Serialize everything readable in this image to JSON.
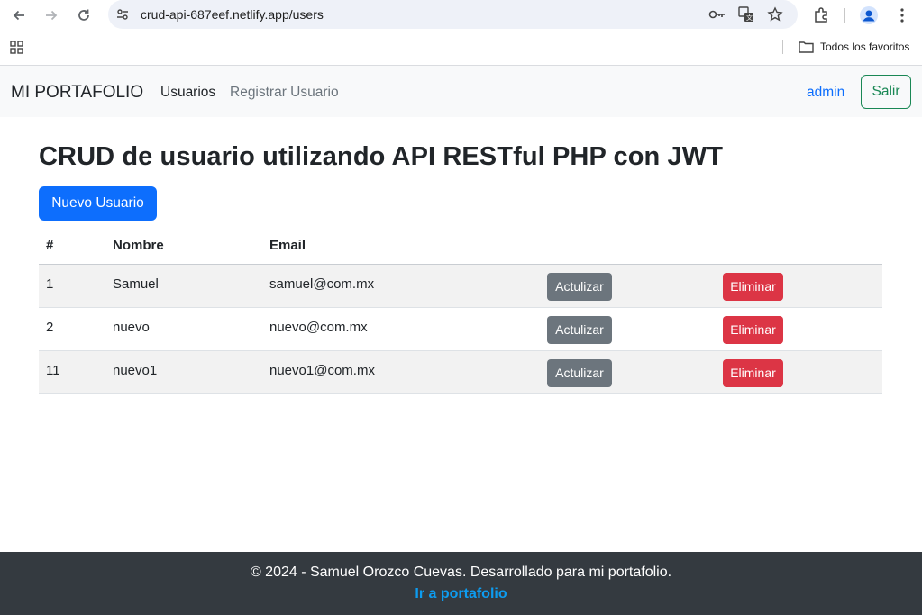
{
  "browser": {
    "url": "crud-api-687eef.netlify.app/users",
    "bookmark_folder": "Todos los favoritos"
  },
  "nav": {
    "brand": "MI PORTAFOLIO",
    "links": [
      "Usuarios",
      "Registrar Usuario"
    ],
    "user": "admin",
    "logout": "Salir"
  },
  "main": {
    "title": "CRUD de usuario utilizando API RESTful PHP con JWT",
    "new_button": "Nuevo Usuario",
    "columns": [
      "#",
      "Nombre",
      "Email"
    ],
    "rows": [
      {
        "id": "1",
        "name": "Samuel",
        "email": "samuel@com.mx"
      },
      {
        "id": "2",
        "name": "nuevo",
        "email": "nuevo@com.mx"
      },
      {
        "id": "11",
        "name": "nuevo1",
        "email": "nuevo1@com.mx"
      }
    ],
    "edit_label": "Actulizar",
    "delete_label": "Eliminar"
  },
  "footer": {
    "text": "© 2024 - Samuel Orozco Cuevas. Desarrollado para mi portafolio.",
    "link": "Ir a portafolio"
  },
  "colors": {
    "primary": "#0d6efd",
    "secondary": "#6c757d",
    "danger": "#dc3545",
    "success": "#198754",
    "footer_bg": "#343a40"
  }
}
